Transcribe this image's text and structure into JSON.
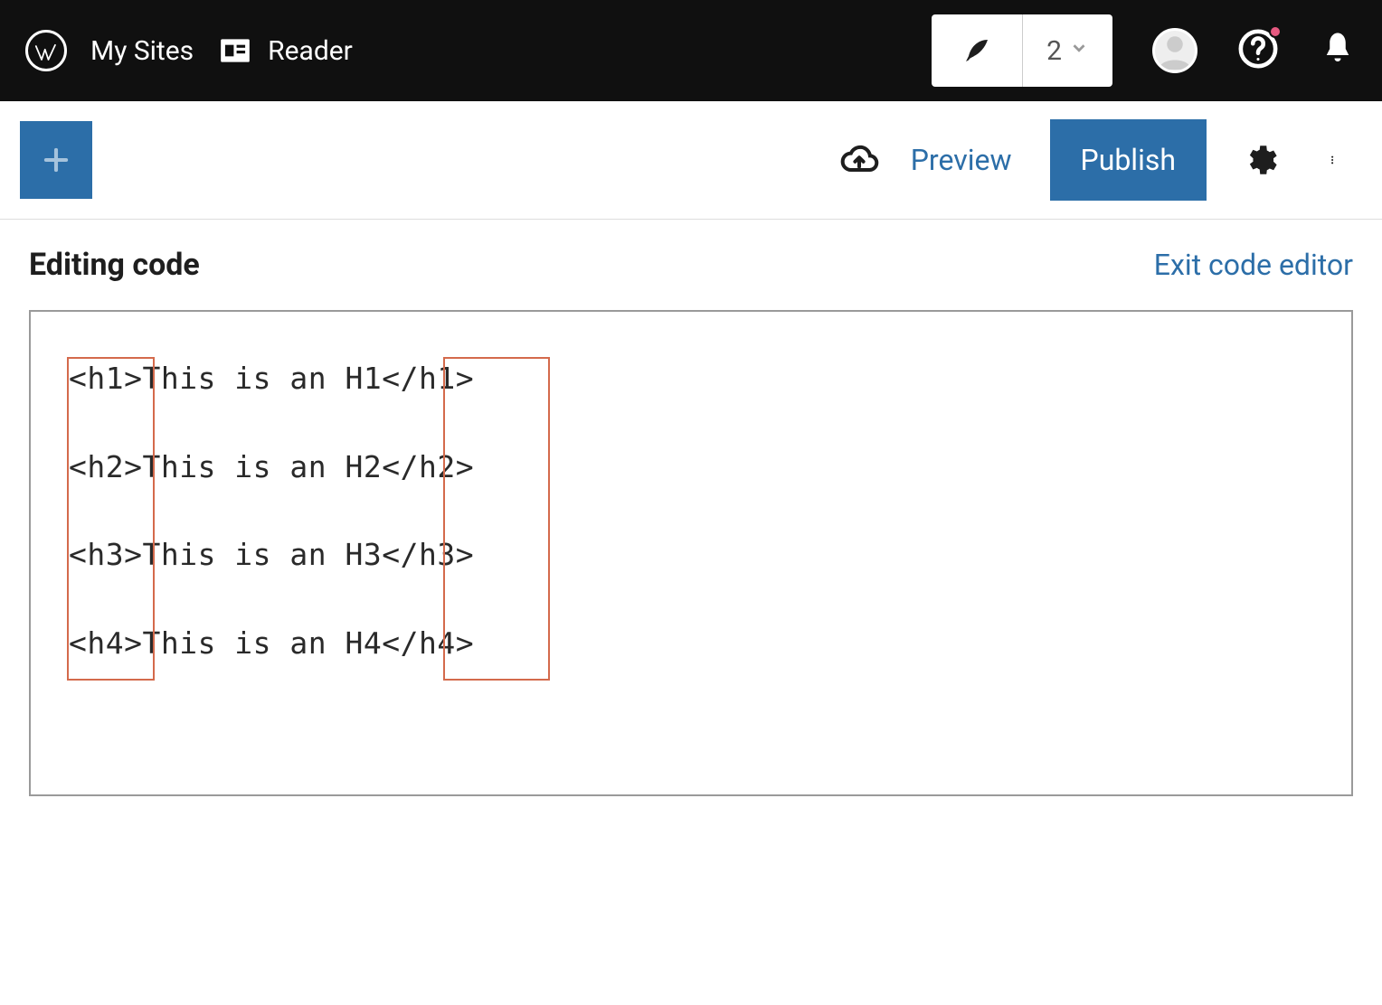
{
  "topbar": {
    "my_sites": "My Sites",
    "reader": "Reader",
    "draft_count": "2"
  },
  "editorbar": {
    "preview": "Preview",
    "publish": "Publish"
  },
  "codeheader": {
    "title": "Editing code",
    "exit": "Exit code editor"
  },
  "code": {
    "lines": [
      "<h1>This is an H1</h1>",
      "<h2>This is an H2</h2>",
      "<h3>This is an H3</h3>",
      "<h4>This is an H4</h4>"
    ]
  },
  "annotations": {
    "open_tag_highlight": true,
    "close_tag_highlight": true
  },
  "colors": {
    "accent": "#2c6ea8",
    "highlight_border": "#d46a4c",
    "topbar_bg": "#101010"
  }
}
